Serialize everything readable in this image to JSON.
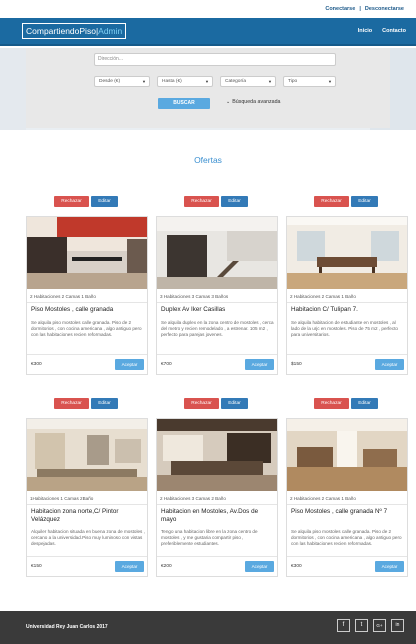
{
  "topbar": {
    "login": "Conectarse",
    "separator": "|",
    "logout": "Desconectarse"
  },
  "brand": {
    "name": "CompartiendoPiso",
    "bar": "|",
    "suffix": "Admin"
  },
  "nav": {
    "home": "Inicio",
    "contact": "Contacto"
  },
  "search": {
    "placeholder": "Dirección...",
    "from": "Desde (€)",
    "to": "Hasta (€)",
    "category": "Categoría",
    "type": "Tipo",
    "button": "BUSCAR",
    "advanced": "Búsqueda avanzada"
  },
  "section_title": "Ofertas",
  "actions": {
    "reject": "Rechazar",
    "edit": "Editar",
    "accept": "Aceptar"
  },
  "listings": [
    {
      "features": "2 Habitaciones    2 Camas    1 Baño",
      "title": "Piso Mostoles , calle granada",
      "description": "Se alquila piso mostoles calle granada. Piso de 2 dormitorios , con cocina americana , algo antiguo pero con las habitaciones recien reformadas.",
      "price": "€300"
    },
    {
      "features": "3 Habitaciones    3 Camas    3 Baños",
      "title": "Duplex Av Iker Casillas",
      "description": "Se alquila duplex en la zona centro de mostoles , cerca del metro y recien remodelado , a estrenar. 105 m2 , perfecto para parejas jovenes.",
      "price": "€700"
    },
    {
      "features": "2 Habitaciones    2 Camas    1 Baño",
      "title": "Habitacion C/ Tulipan 7.",
      "description": "Se alquila habitacion de estudiante en mostoles , al lado de la urjc en mostoles. Piso de 75 m2 , perfecto para universitarios.",
      "price": "$150"
    },
    {
      "features": "1Habitaciones    1 Camas    2Baño",
      "title": "Habitacion zona norte,C/ Pintor Velázquez",
      "description": "Alquiler habitacion situada en buena zona de mostoles , cercano a la universidad.Piso muy luminoso con vistas despejadas.",
      "price": "€150"
    },
    {
      "features": "2 Habitaciones    3 Camas    2 Baño",
      "title": "Habitacion en Mostoles, Av.Dos de mayo",
      "description": "Tengo una habitacion libre en la zona centro de mostoles , y me gustaria compartir piso , preferiblemente estudiantes.",
      "price": "€200"
    },
    {
      "features": "2 Habitaciones    2 Camas    1 Baño",
      "title": "Piso Mostoles , calle granada Nº 7",
      "description": "Se alquila piso mostoles calle granada. Piso de 2 dormitorios , con cocina americana , algo antiguo pero con las habitaciones recien reformadas.",
      "price": "€300"
    }
  ],
  "footer": {
    "text": "Universidad Rey Juan Carlos 2017"
  },
  "social": [
    {
      "icon": "facebook-icon",
      "glyph": "f"
    },
    {
      "icon": "twitter-icon",
      "glyph": "t"
    },
    {
      "icon": "google-plus-icon",
      "glyph": "G+"
    },
    {
      "icon": "linkedin-icon",
      "glyph": "in"
    }
  ],
  "colors": {
    "primary": "#1b6aa1",
    "accent": "#5aa9e0",
    "reject": "#d9534f",
    "edit": "#337ab7",
    "footer": "#3a3a3a"
  }
}
